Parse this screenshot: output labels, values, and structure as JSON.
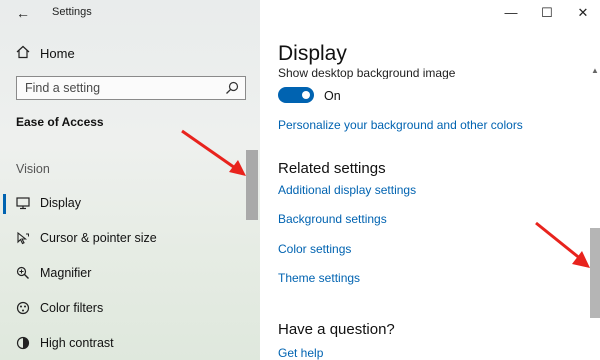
{
  "window": {
    "title": "Settings",
    "back_glyph": "←",
    "minimize_glyph": "—",
    "maximize_glyph": "☐",
    "close_glyph": "✕"
  },
  "sidebar": {
    "home_label": "Home",
    "search_placeholder": "Find a setting",
    "section_title": "Ease of Access",
    "group_label": "Vision",
    "items": [
      {
        "label": "Display",
        "icon": "monitor-icon",
        "active": true
      },
      {
        "label": "Cursor & pointer size",
        "icon": "cursor-icon",
        "active": false
      },
      {
        "label": "Magnifier",
        "icon": "magnifier-icon",
        "active": false
      },
      {
        "label": "Color filters",
        "icon": "color-filters-icon",
        "active": false
      },
      {
        "label": "High contrast",
        "icon": "high-contrast-icon",
        "active": false
      }
    ]
  },
  "main": {
    "title": "Display",
    "partial_setting": "Show desktop background image",
    "toggle": {
      "state": "On",
      "on": true
    },
    "personalize_link": "Personalize your background and other colors",
    "related_heading": "Related settings",
    "related_links": [
      "Additional display settings",
      "Background settings",
      "Color settings",
      "Theme settings"
    ],
    "question_heading": "Have a question?",
    "help_link": "Get help"
  },
  "colors": {
    "accent": "#0063b1",
    "arrow": "#e8231d"
  }
}
